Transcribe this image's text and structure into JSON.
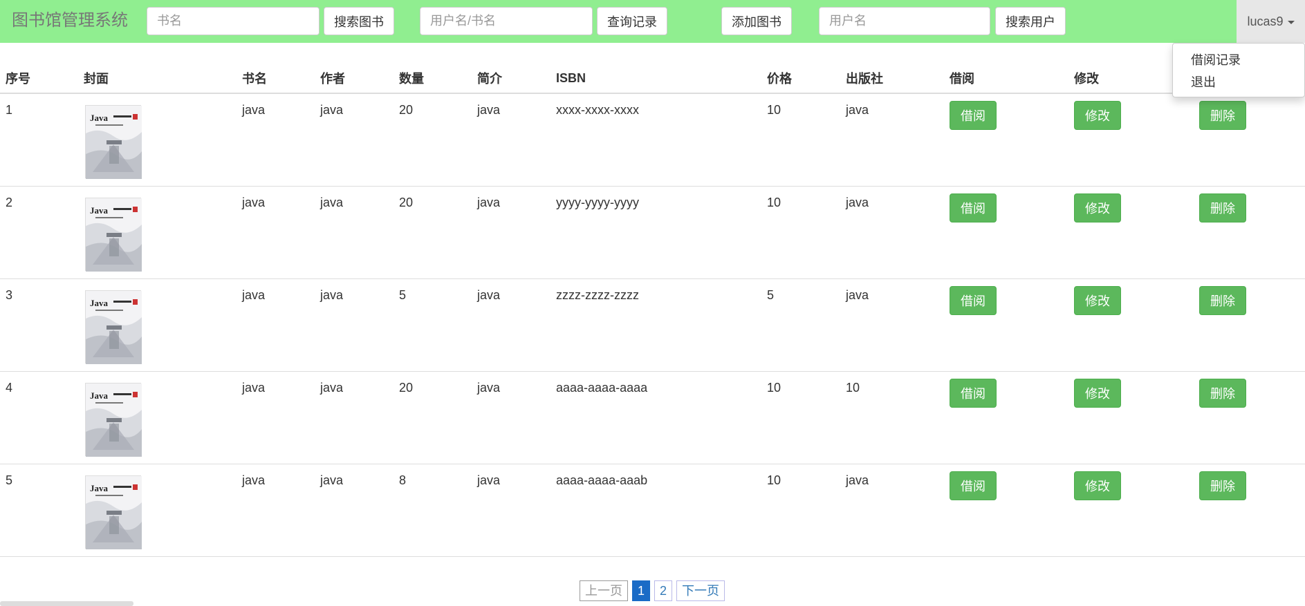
{
  "nav": {
    "brand": "图书馆管理系统",
    "book_search_placeholder": "书名",
    "search_books_label": "搜索图书",
    "record_search_placeholder": "用户名/书名",
    "query_records_label": "查询记录",
    "add_book_label": "添加图书",
    "user_search_placeholder": "用户名",
    "search_users_label": "搜索用户",
    "username": "lucas9"
  },
  "dropdown": {
    "items": [
      "借阅记录",
      "退出"
    ]
  },
  "table": {
    "headers": [
      "序号",
      "封面",
      "书名",
      "作者",
      "数量",
      "简介",
      "ISBN",
      "价格",
      "出版社",
      "借阅",
      "修改",
      "删除"
    ],
    "rows": [
      {
        "id": "1",
        "title": "java",
        "author": "java",
        "quantity": "20",
        "intro": "java",
        "isbn": "xxxx-xxxx-xxxx",
        "price": "10",
        "publisher": "java"
      },
      {
        "id": "2",
        "title": "java",
        "author": "java",
        "quantity": "20",
        "intro": "java",
        "isbn": "yyyy-yyyy-yyyy",
        "price": "10",
        "publisher": "java"
      },
      {
        "id": "3",
        "title": "java",
        "author": "java",
        "quantity": "5",
        "intro": "java",
        "isbn": "zzzz-zzzz-zzzz",
        "price": "5",
        "publisher": "java"
      },
      {
        "id": "4",
        "title": "java",
        "author": "java",
        "quantity": "20",
        "intro": "java",
        "isbn": "aaaa-aaaa-aaaa",
        "price": "10",
        "publisher": "10"
      },
      {
        "id": "5",
        "title": "java",
        "author": "java",
        "quantity": "8",
        "intro": "java",
        "isbn": "aaaa-aaaa-aaab",
        "price": "10",
        "publisher": "java"
      }
    ],
    "borrow_label": "借阅",
    "edit_label": "修改",
    "delete_label": "删除",
    "cover_text": "Java"
  },
  "pagination": {
    "prev_label": "上一页",
    "pages": [
      "1",
      "2"
    ],
    "current": "1",
    "next_label": "下一页"
  },
  "colors": {
    "navbar": "#90ee90",
    "button_green": "#5cb85c",
    "page_active": "#1a6bc6"
  }
}
